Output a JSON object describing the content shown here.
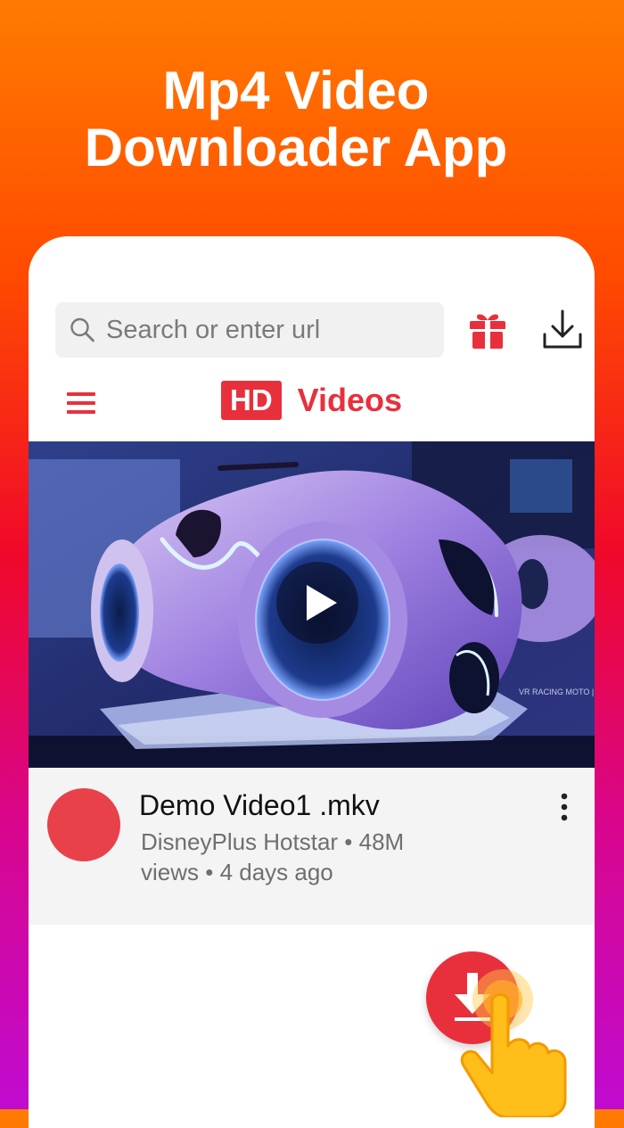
{
  "promo": {
    "title_line1": "Mp4 Video",
    "title_line2": "Downloader App"
  },
  "search": {
    "placeholder": "Search or enter url",
    "value": ""
  },
  "header": {
    "badge": "HD",
    "app_name": "Videos"
  },
  "video": {
    "title": "Demo Video1 .mkv",
    "meta": "DisneyPlus Hotstar • 48M views • 4 days ago"
  },
  "icons": {
    "search": "search-icon",
    "gift": "gift-icon",
    "download": "download-icon",
    "menu": "hamburger-menu-icon",
    "play": "play-icon",
    "more": "more-vertical-icon",
    "hand": "pointing-hand-icon"
  },
  "colors": {
    "accent": "#e8303c",
    "avatar": "#e8414a",
    "gradient_top": "#ff7b00",
    "gradient_bottom": "#c00bd0"
  }
}
